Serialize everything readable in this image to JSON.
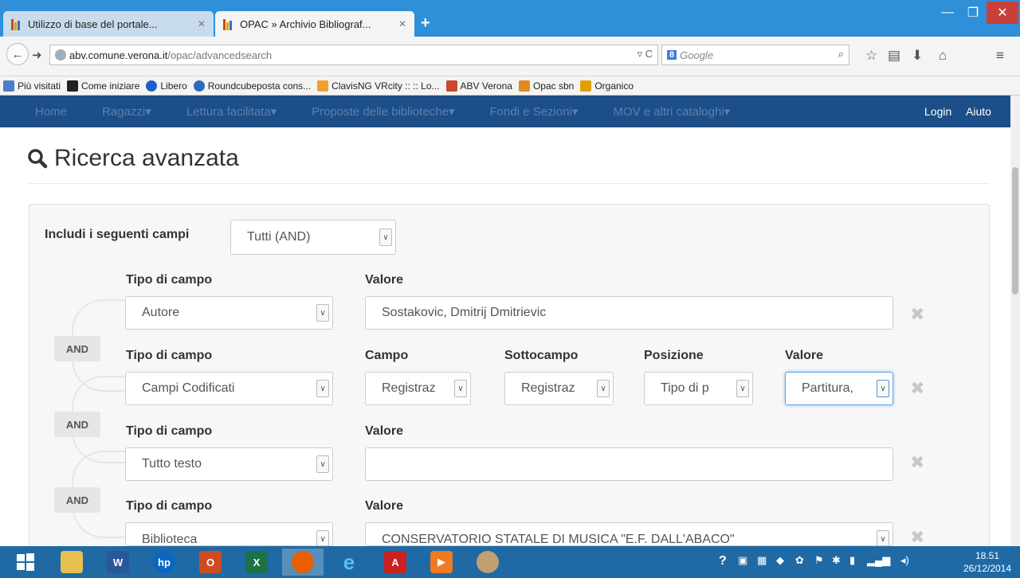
{
  "browser": {
    "tabs": [
      {
        "label": "Utilizzo di base del portale...",
        "active": false
      },
      {
        "label": "OPAC » Archivio Bibliograf...",
        "active": true
      }
    ],
    "new_tab": "+",
    "window": {
      "minimize": "—",
      "maximize": "❐",
      "close": "✕"
    },
    "url_host": "abv.comune.verona.it",
    "url_prefix": "abv.",
    "url_domain": "comune.verona.it",
    "url_path": "/opac/advancedsearch",
    "search_engine": "8",
    "search_placeholder": "Google",
    "bookmarks": [
      {
        "label": "Più visitati",
        "icon": "most-visited-icon",
        "color": "#4a7ec7"
      },
      {
        "label": "Come iniziare",
        "icon": "firefox-m-icon",
        "color": "#222222"
      },
      {
        "label": "Libero",
        "icon": "libero-icon",
        "color": "#1d62c9"
      },
      {
        "label": "Roundcubeposta cons...",
        "icon": "roundcube-icon",
        "color": "#2b6cbf"
      },
      {
        "label": "ClavisNG VRcity :: :: Lo...",
        "icon": "clavis-icon",
        "color": "#f0a030"
      },
      {
        "label": "ABV Verona",
        "icon": "abv-icon",
        "color": "#c84a2a"
      },
      {
        "label": "Opac sbn",
        "icon": "opac-sbn-icon",
        "color": "#e08a20"
      },
      {
        "label": "Organico",
        "icon": "organico-icon",
        "color": "#e0a000"
      }
    ]
  },
  "site_nav": {
    "items": [
      "Home",
      "Ragazzi▾",
      "Lettura facilitata▾",
      "Proposte delle biblioteche▾",
      "Fondi e Sezioni▾",
      "MOV e altri cataloghi▾"
    ],
    "login": "Login",
    "help": "Aiuto"
  },
  "page": {
    "title": "Ricerca avanzata",
    "include_label": "Includi i seguenti campi",
    "include_value": "Tutti (AND)",
    "and_label": "AND",
    "rows": [
      {
        "type_label": "Tipo di campo",
        "type_value": "Autore",
        "value_label": "Valore",
        "value": "Sostakovic, Dmitrij Dmitrievic"
      },
      {
        "type_label": "Tipo di campo",
        "type_value": "Campi Codificati",
        "campo_label": "Campo",
        "campo_value": "Registraz",
        "sottocampo_label": "Sottocampo",
        "sottocampo_value": "Registraz",
        "posizione_label": "Posizione",
        "posizione_value": "Tipo di p",
        "value_label": "Valore",
        "value": "Partitura,"
      },
      {
        "type_label": "Tipo di campo",
        "type_value": "Tutto testo",
        "value_label": "Valore",
        "value": ""
      },
      {
        "type_label": "Tipo di campo",
        "type_value": "Biblioteca",
        "value_label": "Valore",
        "value": "CONSERVATORIO STATALE DI MUSICA \"E.F. DALL'ABACO\""
      }
    ]
  },
  "taskbar": {
    "apps": [
      "windows-start-icon",
      "file-explorer-icon",
      "word-icon",
      "hp-icon",
      "office-icon",
      "excel-icon",
      "firefox-icon",
      "internet-explorer-icon",
      "acrobat-icon",
      "media-player-icon",
      "app-icon"
    ],
    "time": "18.51",
    "date": "26/12/2014"
  }
}
